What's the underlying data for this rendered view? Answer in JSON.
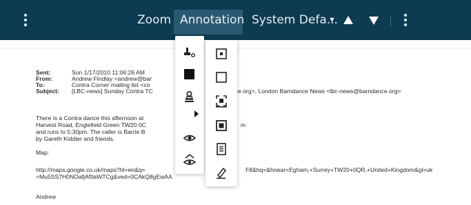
{
  "toolbar": {
    "zoom_label": "Zoom",
    "annotation_label": "Annotation",
    "color_selector_label": "System Defa...",
    "background_color": "#0d3b52",
    "active_tab_color": "#2a5a72"
  },
  "email": {
    "headers": [
      {
        "label": "Sent:",
        "value": "Sun 1/17/2010 11:06:26 AM"
      },
      {
        "label": "From:",
        "value": "Andrew Findlay <andrew@bar"
      },
      {
        "label": "To:",
        "value": "Contra Corner mailing list <co"
      },
      {
        "label": "Subject:",
        "value": "[LBC-news] Sunday Contra TC"
      }
    ],
    "to_continuation": "nce.org>, London Barndance News <lbc-news@barndance.org>",
    "body_lines": [
      "There is a Contra dance this afternoon at",
      "Harvest Road, Englefield Green TW20 0C",
      "and runs to 5:30pm. The caller is Barrie B",
      "by Gareth Kiddier and friends."
    ],
    "body_line2_tail": "m",
    "map_label": "Map:",
    "url_line1_start": "http://maps.google.co.uk/maps?hl=en&q=",
    "url_line1_end": "F8&hq=&hnear=Egham,+Surrey+TW20+0QR,+United+Kingdom&gl=uk",
    "url_line2": "=Mu5SS7H0NOafjAftlaWTCg&ved=0CAkQ8gEwAA",
    "signature": "Andrew"
  }
}
